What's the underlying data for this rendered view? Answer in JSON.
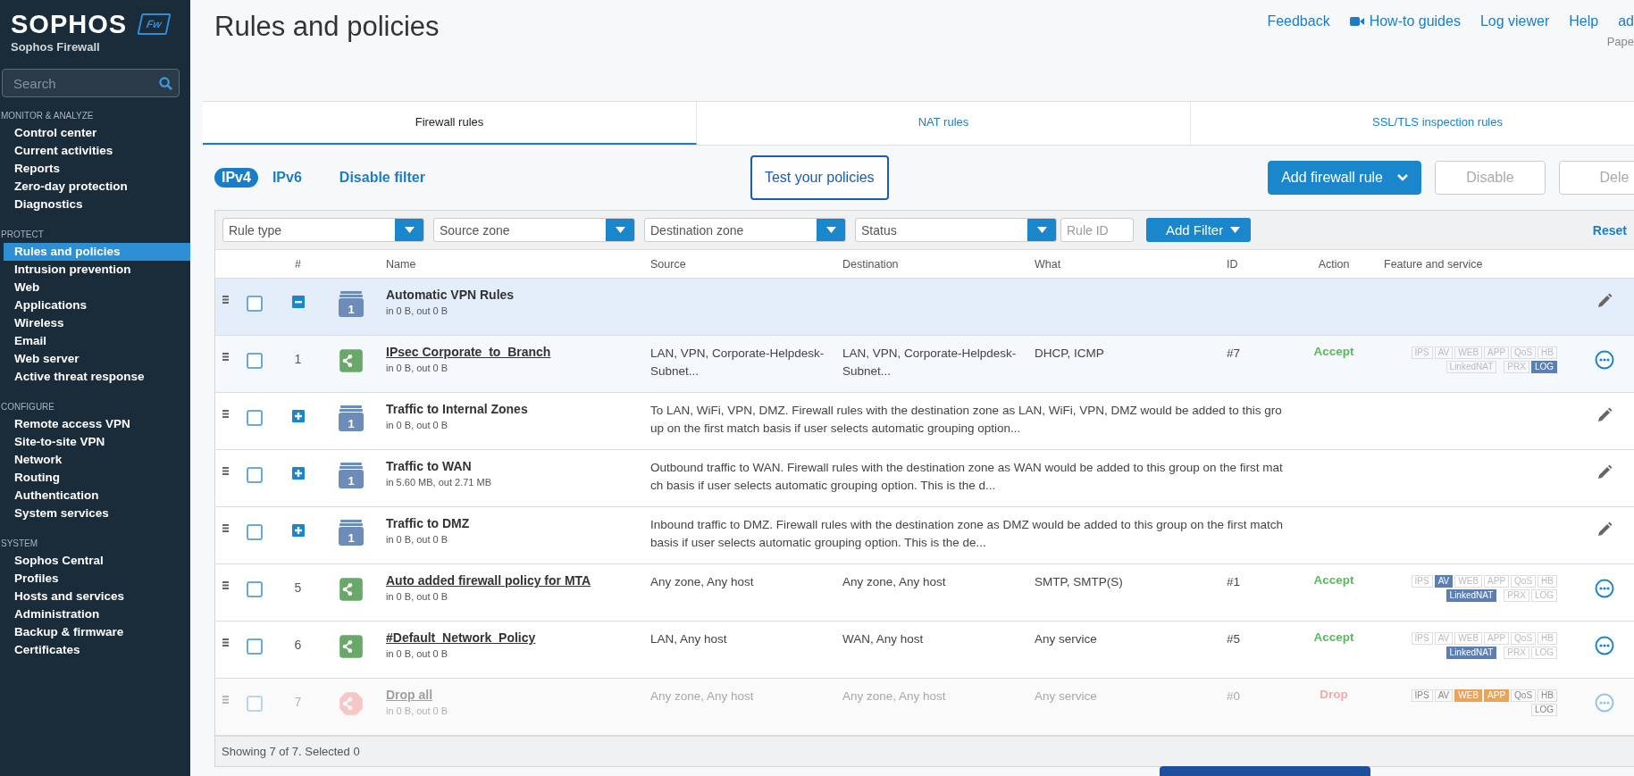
{
  "sidebar": {
    "logo": "SOPHOS",
    "logo_badge": "Fw",
    "product": "Sophos Firewall",
    "search": {
      "placeholder": "Search"
    },
    "sections": [
      {
        "title": "MONITOR & ANALYZE",
        "items": [
          {
            "label": "Control center",
            "selected": false
          },
          {
            "label": "Current activities",
            "selected": false
          },
          {
            "label": "Reports",
            "selected": false
          },
          {
            "label": "Zero-day protection",
            "selected": false
          },
          {
            "label": "Diagnostics",
            "selected": false
          }
        ]
      },
      {
        "title": "PROTECT",
        "items": [
          {
            "label": "Rules and policies",
            "selected": true
          },
          {
            "label": "Intrusion prevention",
            "selected": false
          },
          {
            "label": "Web",
            "selected": false
          },
          {
            "label": "Applications",
            "selected": false
          },
          {
            "label": "Wireless",
            "selected": false
          },
          {
            "label": "Email",
            "selected": false
          },
          {
            "label": "Web server",
            "selected": false
          },
          {
            "label": "Active threat response",
            "selected": false
          }
        ]
      },
      {
        "title": "CONFIGURE",
        "items": [
          {
            "label": "Remote access VPN",
            "selected": false
          },
          {
            "label": "Site-to-site VPN",
            "selected": false
          },
          {
            "label": "Network",
            "selected": false
          },
          {
            "label": "Routing",
            "selected": false
          },
          {
            "label": "Authentication",
            "selected": false
          },
          {
            "label": "System services",
            "selected": false
          }
        ]
      },
      {
        "title": "SYSTEM",
        "items": [
          {
            "label": "Sophos Central",
            "selected": false
          },
          {
            "label": "Profiles",
            "selected": false
          },
          {
            "label": "Hosts and services",
            "selected": false
          },
          {
            "label": "Administration",
            "selected": false
          },
          {
            "label": "Backup & firmware",
            "selected": false
          },
          {
            "label": "Certificates",
            "selected": false
          }
        ]
      }
    ]
  },
  "page_title": "Rules and policies",
  "top_links": [
    {
      "label": "Feedback",
      "kind": "link"
    },
    {
      "label": "How-to guides",
      "kind": "video"
    },
    {
      "label": "Log viewer",
      "kind": "link"
    },
    {
      "label": "Help",
      "kind": "link"
    },
    {
      "label": "ad",
      "kind": "link"
    }
  ],
  "user_subtitle": "Pape",
  "tabs": [
    {
      "label": "Firewall rules",
      "selected": true
    },
    {
      "label": "NAT rules",
      "selected": false
    },
    {
      "label": "SSL/TLS inspection rules",
      "selected": false
    }
  ],
  "ip_toggle": [
    {
      "label": "IPv4",
      "selected": true
    },
    {
      "label": "IPv6",
      "selected": false
    }
  ],
  "disable_filter": "Disable filter",
  "test_button": "Test your policies",
  "actions": [
    {
      "label": "Add firewall rule",
      "kind": "dropdown",
      "disabled": false
    },
    {
      "label": "Disable",
      "kind": "plain",
      "disabled": true
    },
    {
      "label": "Dele",
      "kind": "plain",
      "disabled": true
    }
  ],
  "filters": [
    {
      "placeholder": "Rule type",
      "kind": "select"
    },
    {
      "placeholder": "Source zone",
      "kind": "select"
    },
    {
      "placeholder": "Destination zone",
      "kind": "select"
    },
    {
      "placeholder": "Status",
      "kind": "select"
    },
    {
      "placeholder": "Rule ID",
      "kind": "input"
    }
  ],
  "add_filter": "Add Filter",
  "reset": "Reset",
  "table": {
    "columns": [
      "#",
      "Name",
      "Source",
      "Destination",
      "What",
      "ID",
      "Action",
      "Feature and service"
    ],
    "rows": [
      {
        "kind": "group",
        "name": "Automatic VPN Rules",
        "traffic": "in 0 B, out 0 B",
        "count": "1",
        "expanded": true,
        "checked": false,
        "children": [
          {
            "kind": "accept",
            "number": "1",
            "name": "IPsec Corporate_to_Branch",
            "traffic": "in 0 B, out 0 B",
            "source": "LAN, VPN, Corporate-Helpdesk-Subnet...",
            "destination": "LAN, VPN, Corporate-Helpdesk-Subnet...",
            "what": "DHCP, ICMP",
            "id": "#7",
            "action": "Accept",
            "disabled": false,
            "checked": false,
            "features": {
              "line1": [
                {
                  "label": "IPS",
                  "on": false
                },
                {
                  "label": "AV",
                  "on": false
                },
                {
                  "label": "WEB",
                  "on": false
                },
                {
                  "label": "APP",
                  "on": false
                },
                {
                  "label": "QoS",
                  "on": false
                },
                {
                  "label": "HB",
                  "on": false
                }
              ],
              "line2": [
                {
                  "label": "LinkedNAT",
                  "on": false
                },
                {
                  "label": "PRX",
                  "on": false
                },
                {
                  "label": "LOG",
                  "on": true,
                  "color": "#5b7fb5"
                }
              ]
            }
          }
        ]
      },
      {
        "kind": "group",
        "name": "Traffic to Internal Zones",
        "traffic": "in 0 B, out 0 B",
        "count": "1",
        "expanded": false,
        "checked": false,
        "description": "To LAN, WiFi, VPN, DMZ. Firewall rules with the destination zone as LAN, WiFi, VPN, DMZ would be added to this group on the first match basis if user selects automatic grouping option..."
      },
      {
        "kind": "group",
        "name": "Traffic to WAN",
        "traffic": "in 5.60 MB, out 2.71 MB",
        "count": "1",
        "expanded": false,
        "checked": false,
        "description": "Outbound traffic to WAN. Firewall rules with the destination zone as WAN would be added to this group on the first match basis if user selects automatic grouping option. This is the d..."
      },
      {
        "kind": "group",
        "name": "Traffic to DMZ",
        "traffic": "in 0 B, out 0 B",
        "count": "1",
        "expanded": false,
        "checked": false,
        "description": "Inbound traffic to DMZ. Firewall rules with the destination zone as DMZ would be added to this group on the first match basis if user selects automatic grouping option. This is the de..."
      },
      {
        "kind": "accept",
        "number": "5",
        "name": "Auto added firewall policy for MTA",
        "traffic": "in 0 B, out 0 B",
        "source": "Any zone, Any host",
        "destination": "Any zone, Any host",
        "what": "SMTP, SMTP(S)",
        "id": "#1",
        "action": "Accept",
        "disabled": false,
        "checked": false,
        "features": {
          "line1": [
            {
              "label": "IPS",
              "on": false
            },
            {
              "label": "AV",
              "on": true,
              "color": "#5b7fb5"
            },
            {
              "label": "WEB",
              "on": false
            },
            {
              "label": "APP",
              "on": false
            },
            {
              "label": "QoS",
              "on": false
            },
            {
              "label": "HB",
              "on": false
            }
          ],
          "line2": [
            {
              "label": "LinkedNAT",
              "on": true,
              "color": "#5b7fb5"
            },
            {
              "label": "PRX",
              "on": false
            },
            {
              "label": "LOG",
              "on": false
            }
          ]
        }
      },
      {
        "kind": "accept",
        "number": "6",
        "name": "#Default_Network_Policy",
        "traffic": "in 0 B, out 0 B",
        "source": "LAN, Any host",
        "destination": "WAN, Any host",
        "what": "Any service",
        "id": "#5",
        "action": "Accept",
        "disabled": false,
        "checked": false,
        "features": {
          "line1": [
            {
              "label": "IPS",
              "on": false
            },
            {
              "label": "AV",
              "on": false
            },
            {
              "label": "WEB",
              "on": false
            },
            {
              "label": "APP",
              "on": false
            },
            {
              "label": "QoS",
              "on": false
            },
            {
              "label": "HB",
              "on": false
            }
          ],
          "line2": [
            {
              "label": "LinkedNAT",
              "on": true,
              "color": "#5b7fb5"
            },
            {
              "label": "PRX",
              "on": false
            },
            {
              "label": "LOG",
              "on": false
            }
          ]
        }
      },
      {
        "kind": "drop",
        "number": "7",
        "name": "Drop all",
        "traffic": "in 0 B, out 0 B",
        "source": "Any zone, Any host",
        "destination": "Any zone, Any host",
        "what": "Any service",
        "id": "#0",
        "action": "Drop",
        "disabled": true,
        "checked": false,
        "features": {
          "line1": [
            {
              "label": "IPS",
              "on": false
            },
            {
              "label": "AV",
              "on": false
            },
            {
              "label": "WEB",
              "on": true,
              "color": "#e9a45c"
            },
            {
              "label": "APP",
              "on": true,
              "color": "#e9a45c"
            },
            {
              "label": "QoS",
              "on": false
            },
            {
              "label": "HB",
              "on": false
            }
          ],
          "line2": [
            {
              "label": "LOG",
              "on": false
            }
          ]
        }
      }
    ]
  },
  "status_bar": "Showing 7 of 7. Selected 0"
}
